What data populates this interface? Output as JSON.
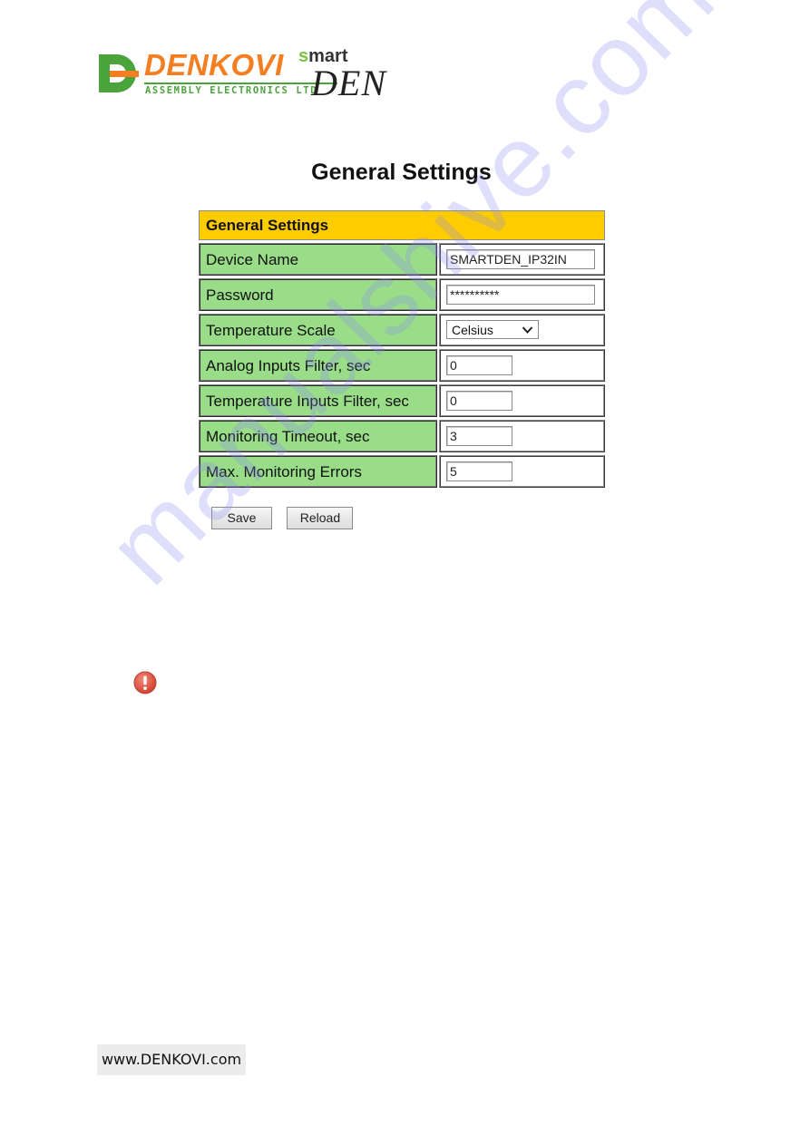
{
  "logo": {
    "brand": "DENKOVI",
    "subtitle": "ASSEMBLY ELECTRONICS LTD",
    "product_prefix_s": "s",
    "product_prefix_rest": "mart",
    "product_name": "DEN",
    "colors": {
      "orange": "#f57f20",
      "green": "#4aa33b",
      "light_green": "#7cc242"
    }
  },
  "page_title": "General Settings",
  "settings": {
    "header": "General Settings",
    "header_color": "#ffcc00",
    "label_color": "#99dd88",
    "rows": [
      {
        "label": "Device Name",
        "type": "text",
        "value": "SMARTDEN_IP32IN"
      },
      {
        "label": "Password",
        "type": "password",
        "value": "**********"
      },
      {
        "label": "Temperature Scale",
        "type": "select",
        "value": "Celsius"
      },
      {
        "label": "Analog Inputs Filter, sec",
        "type": "text",
        "value": "0"
      },
      {
        "label": "Temperature Inputs Filter, sec",
        "type": "text",
        "value": "0"
      },
      {
        "label": "Monitoring Timeout, sec",
        "type": "text",
        "value": "3"
      },
      {
        "label": "Max. Monitoring Errors",
        "type": "text",
        "value": "5"
      }
    ]
  },
  "buttons": {
    "save": "Save",
    "reload": "Reload"
  },
  "icons": {
    "warning": "exclamation-circle-icon"
  },
  "footer": "www.DENKOVI.com",
  "watermark": "manualshive.com"
}
